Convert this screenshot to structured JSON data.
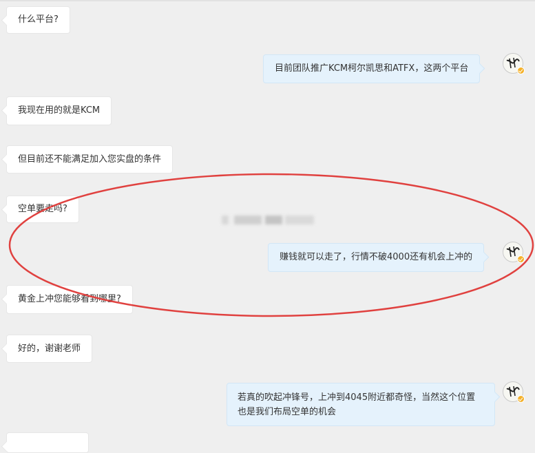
{
  "messages": [
    {
      "side": "left",
      "text": "什么平台?"
    },
    {
      "side": "right",
      "text": "目前团队推广KCM柯尔凯思和ATFX，这两个平台"
    },
    {
      "side": "left",
      "text": "我现在用的就是KCM"
    },
    {
      "side": "left",
      "text": "但目前还不能满足加入您实盘的条件"
    },
    {
      "side": "left",
      "text": "空单要走吗?"
    },
    {
      "side": "right",
      "text": "赚钱就可以走了，行情不破4000还有机会上冲的"
    },
    {
      "side": "left",
      "text": "黄金上冲您能够看到哪里?"
    },
    {
      "side": "left",
      "text": "好的，谢谢老师"
    },
    {
      "side": "right",
      "text": "若真的吹起冲锋号，上冲到4045附近都奇怪，当然这个位置也是我们布局空单的机会"
    }
  ],
  "avatar_icon": "teacher-avatar-icon",
  "badge_icon": "verified-badge-icon",
  "colors": {
    "background": "#efefef",
    "incoming_bubble": "#ffffff",
    "outgoing_bubble": "#e5f2fc",
    "annotation_red": "#e0413f",
    "badge": "#f4b12a"
  }
}
